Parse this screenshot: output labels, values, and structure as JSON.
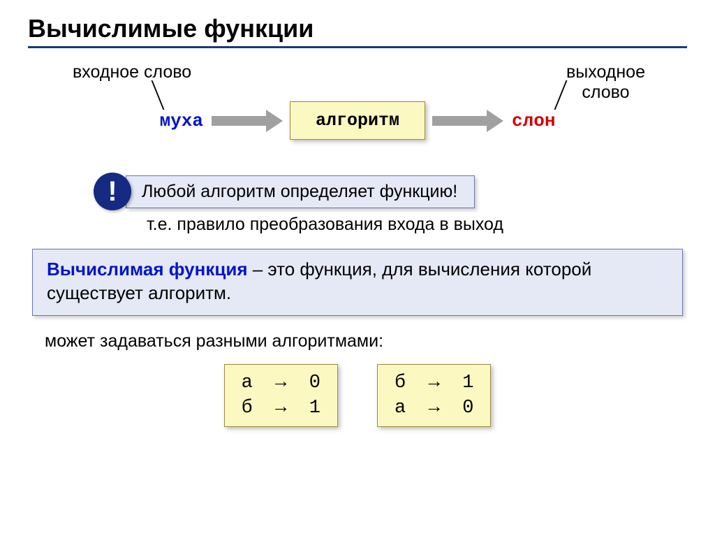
{
  "title": "Вычислимые функции",
  "diagram": {
    "input_label": "входное слово",
    "output_label": "выходное\nслово",
    "input_word": "муха",
    "algorithm": "алгоритм",
    "output_word": "слон"
  },
  "callout": {
    "bang": "!",
    "text": "Любой алгоритм определяет функцию!"
  },
  "subnote": "т.е. правило преобразования входа в выход",
  "definition": {
    "term": "Вычислимая функция",
    "rest": " – это функция, для вычисления которой существует алгоритм."
  },
  "note": "может задаваться разными алгоритмами:",
  "rules": {
    "box1": {
      "line1": "а  →  0",
      "line2": "б  →  1"
    },
    "box2": {
      "line1": "б  →  1",
      "line2": "а  →  0"
    }
  }
}
